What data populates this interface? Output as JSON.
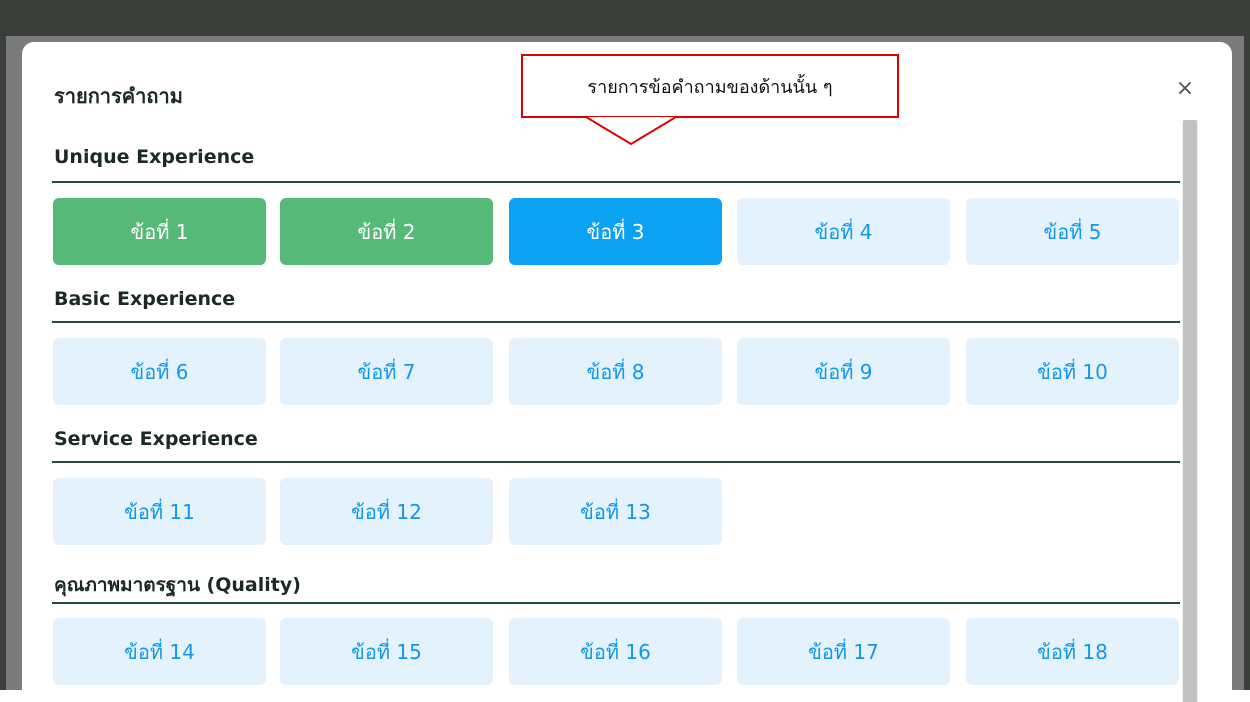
{
  "modal": {
    "title": "รายการคำถาม",
    "close_label": "×"
  },
  "callout": {
    "text": "รายการข้อคำถามของด้านนั้น ๆ",
    "border_color": "#e00000"
  },
  "colors": {
    "done": "#57b978",
    "current": "#0aa2f1",
    "todo_bg": "#e3f2fd",
    "todo_text": "#1597e9",
    "section_line": "#244a3a"
  },
  "sections": [
    {
      "title": "Unique Experience",
      "items": [
        {
          "label": "ข้อที่ 1",
          "status": "done"
        },
        {
          "label": "ข้อที่ 2",
          "status": "done"
        },
        {
          "label": "ข้อที่ 3",
          "status": "current"
        },
        {
          "label": "ข้อที่ 4",
          "status": "todo"
        },
        {
          "label": "ข้อที่ 5",
          "status": "todo"
        }
      ]
    },
    {
      "title": "Basic Experience",
      "items": [
        {
          "label": "ข้อที่ 6",
          "status": "todo"
        },
        {
          "label": "ข้อที่ 7",
          "status": "todo"
        },
        {
          "label": "ข้อที่ 8",
          "status": "todo"
        },
        {
          "label": "ข้อที่ 9",
          "status": "todo"
        },
        {
          "label": "ข้อที่ 10",
          "status": "todo"
        }
      ]
    },
    {
      "title": "Service Experience",
      "items": [
        {
          "label": "ข้อที่ 11",
          "status": "todo"
        },
        {
          "label": "ข้อที่ 12",
          "status": "todo"
        },
        {
          "label": "ข้อที่ 13",
          "status": "todo"
        }
      ]
    },
    {
      "title": "คุณภาพมาตรฐาน (Quality)",
      "items": [
        {
          "label": "ข้อที่ 14",
          "status": "todo"
        },
        {
          "label": "ข้อที่ 15",
          "status": "todo"
        },
        {
          "label": "ข้อที่ 16",
          "status": "todo"
        },
        {
          "label": "ข้อที่ 17",
          "status": "todo"
        },
        {
          "label": "ข้อที่ 18",
          "status": "todo"
        }
      ]
    }
  ]
}
